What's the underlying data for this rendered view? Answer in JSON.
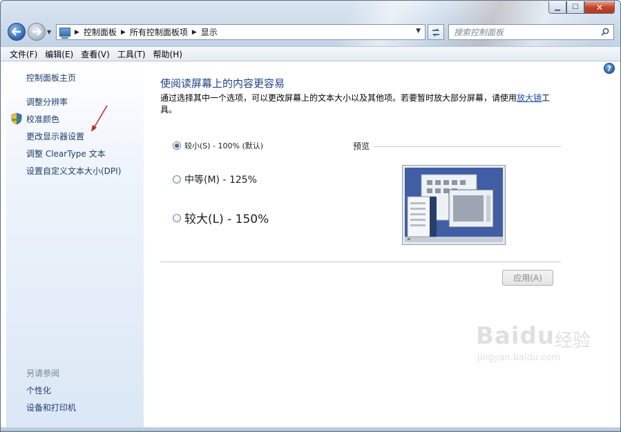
{
  "window": {
    "caption_minimize": "▁",
    "caption_maximize": "☐",
    "caption_close": "✕"
  },
  "nav": {
    "back_icon": "back-arrow-icon",
    "forward_icon": "forward-arrow-icon",
    "breadcrumbs": [
      "控制面板",
      "所有控制面板项",
      "显示"
    ],
    "search_placeholder": "搜索控制面板"
  },
  "menu": [
    "文件(F)",
    "编辑(E)",
    "查看(V)",
    "工具(T)",
    "帮助(H)"
  ],
  "sidebar": {
    "home": "控制面板主页",
    "links": [
      "调整分辨率",
      "校准颜色",
      "更改显示器设置",
      "调整 ClearType 文本",
      "设置自定义文本大小(DPI)"
    ],
    "see_also_title": "另请参阅",
    "see_also": [
      "个性化",
      "设备和打印机"
    ]
  },
  "main": {
    "title": "使阅读屏幕上的内容更容易",
    "desc_before": "通过选择其中一个选项，可以更改屏幕上的文本大小以及其他项。若要暂时放大部分屏幕，请使用",
    "desc_link": "放大镜",
    "desc_after": "工具。",
    "options": [
      {
        "label": "较小(S) - 100% (默认)",
        "checked": true
      },
      {
        "label": "中等(M) - 125%",
        "checked": false
      },
      {
        "label": "较大(L) - 150%",
        "checked": false
      }
    ],
    "preview_label": "预览",
    "apply_label": "应用(A)",
    "help_label": "?"
  },
  "watermark": {
    "brand": "Baidu",
    "brand_cn": "经验",
    "url": "jingyan.baidu.com"
  },
  "colors": {
    "link": "#1d3d6e",
    "title": "#1e3e8a",
    "accent_link": "#1a4fb0",
    "annotation_arrow": "#cc1f1f"
  }
}
